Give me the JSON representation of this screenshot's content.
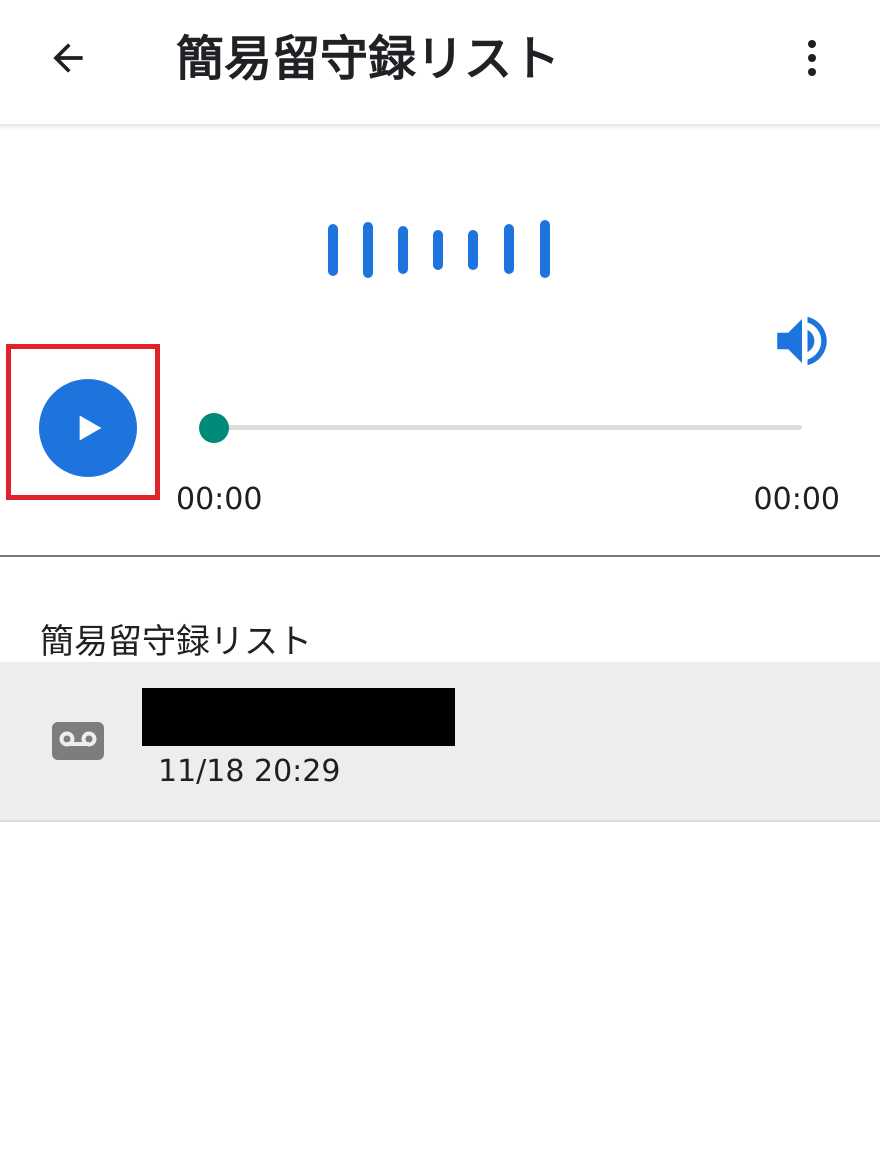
{
  "app_bar": {
    "title": "簡易留守録リスト",
    "back_icon": "arrow-back-icon",
    "overflow_icon": "more-vert-icon"
  },
  "player": {
    "waveform_icon": "waveform-icon",
    "volume_icon": "volume-up-icon",
    "play_icon": "play-icon",
    "current_time": "00:00",
    "total_time": "00:00",
    "progress_fraction": 0,
    "colors": {
      "accent": "#1e74dd",
      "seek": "#008a78",
      "highlight": "#e0222a"
    }
  },
  "list": {
    "heading": "簡易留守録リスト",
    "items": [
      {
        "icon": "voicemail-icon",
        "caller": "",
        "datetime": "11/18 20:29"
      }
    ]
  }
}
